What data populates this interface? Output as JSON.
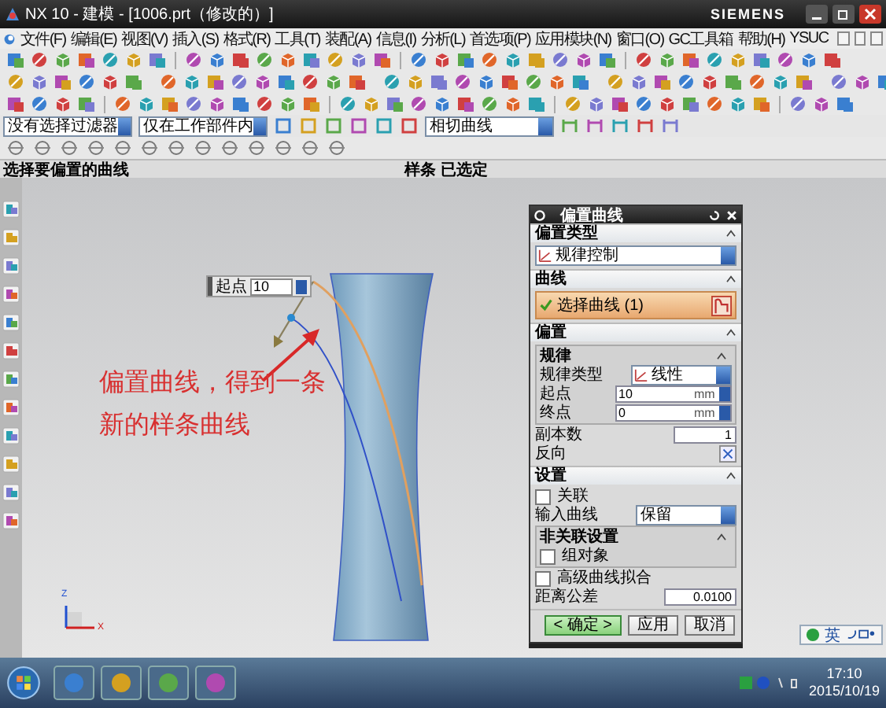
{
  "window": {
    "title": "NX 10 - 建模 - [1006.prt（修改的）]",
    "brand": "SIEMENS"
  },
  "menu": [
    "文件(F)",
    "编辑(E)",
    "视图(V)",
    "插入(S)",
    "格式(R)",
    "工具(T)",
    "装配(A)",
    "信息(I)",
    "分析(L)",
    "首选项(P)",
    "应用模块(N)",
    "窗口(O)",
    "GC工具箱",
    "帮助(H)",
    "YSUC"
  ],
  "selection_bar": {
    "filter": "没有选择过滤器",
    "scope": "仅在工作部件内",
    "curve_rule": "相切曲线"
  },
  "cue_line": {
    "prompt": "选择要偏置的曲线",
    "status": "样条 已选定"
  },
  "viewport": {
    "annotation": [
      "偏置曲线，得到一条",
      "新的样条曲线"
    ],
    "onscreen_input": {
      "label": "起点",
      "value": "10"
    },
    "axis": {
      "z": "Z",
      "x": "X"
    }
  },
  "dialog": {
    "title": "偏置曲线",
    "offset_type": {
      "heading": "偏置类型",
      "value": "规律控制"
    },
    "curve": {
      "heading": "曲线",
      "select_label": "选择曲线 (1)",
      "selected": true
    },
    "offset": {
      "heading": "偏置",
      "law": {
        "heading": "规律",
        "law_type_label": "规律类型",
        "law_type": "线性",
        "start_label": "起点",
        "start": "10",
        "start_unit": "mm",
        "end_label": "终点",
        "end": "0",
        "end_unit": "mm"
      },
      "copies_label": "副本数",
      "copies": "1",
      "reverse_label": "反向"
    },
    "settings": {
      "heading": "设置",
      "associative": {
        "label": "关联",
        "checked": false
      },
      "input_curve_label": "输入曲线",
      "input_curve": "保留",
      "nonassoc": {
        "heading": "非关联设置",
        "group_objects": {
          "label": "组对象",
          "checked": false
        }
      },
      "advanced_fit": {
        "label": "高级曲线拟合",
        "checked": false
      },
      "tolerance_label": "距离公差",
      "tolerance": "0.0100"
    },
    "buttons": [
      "< 确定 >",
      "应用",
      "取消"
    ]
  },
  "ime": {
    "mode": "英"
  },
  "taskbar": {
    "time": "17:10",
    "date": "2015/10/19"
  }
}
